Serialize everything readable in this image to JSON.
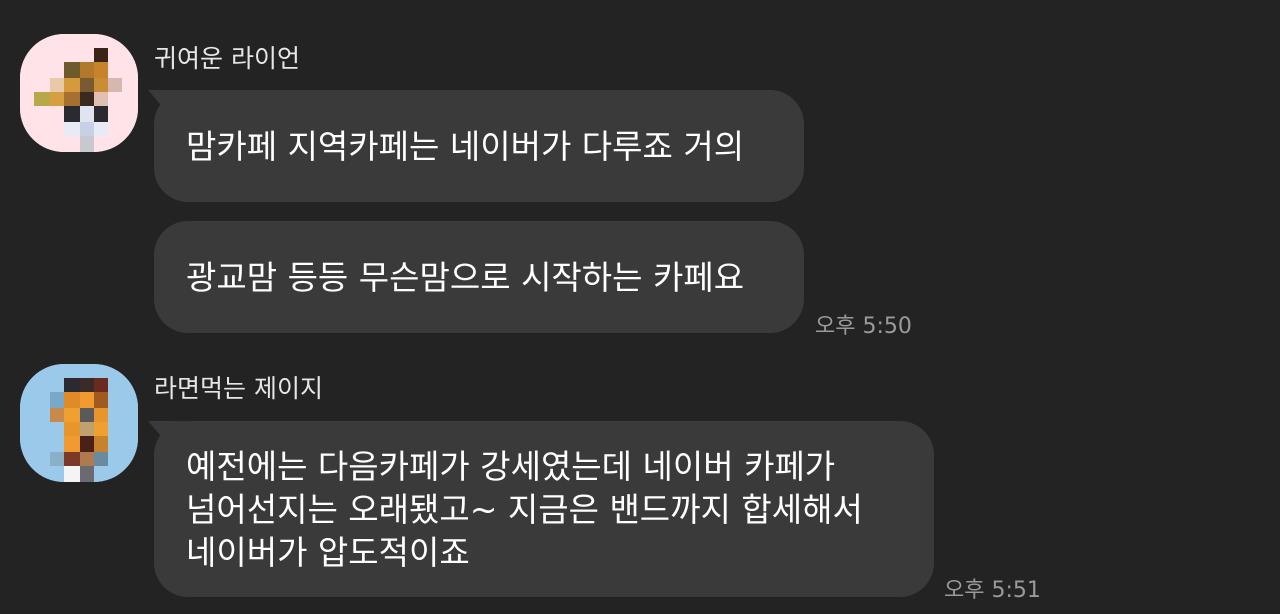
{
  "chat": {
    "groups": [
      {
        "sender": "귀여운 라이언",
        "avatar_bg": "#ffe3e8",
        "messages": [
          "맘카페 지역카페는 네이버가 다루죠 거의",
          "광교맘 등등 무슨맘으로 시작하는 카페요"
        ],
        "time": "오후 5:50"
      },
      {
        "sender": "라면먹는 제이지",
        "avatar_bg": "#9bc9ea",
        "messages": [
          "예전에는 다음카페가 강세였는데 네이버 카페가\n넘어선지는 오래됐고~ 지금은 밴드까지 합세해서\n네이버가 압도적이죠"
        ],
        "time": "오후 5:51"
      }
    ]
  },
  "colors": {
    "background": "#232323",
    "bubble": "#3a3a3a",
    "text": "#ffffff",
    "time": "#9a9a9a"
  }
}
